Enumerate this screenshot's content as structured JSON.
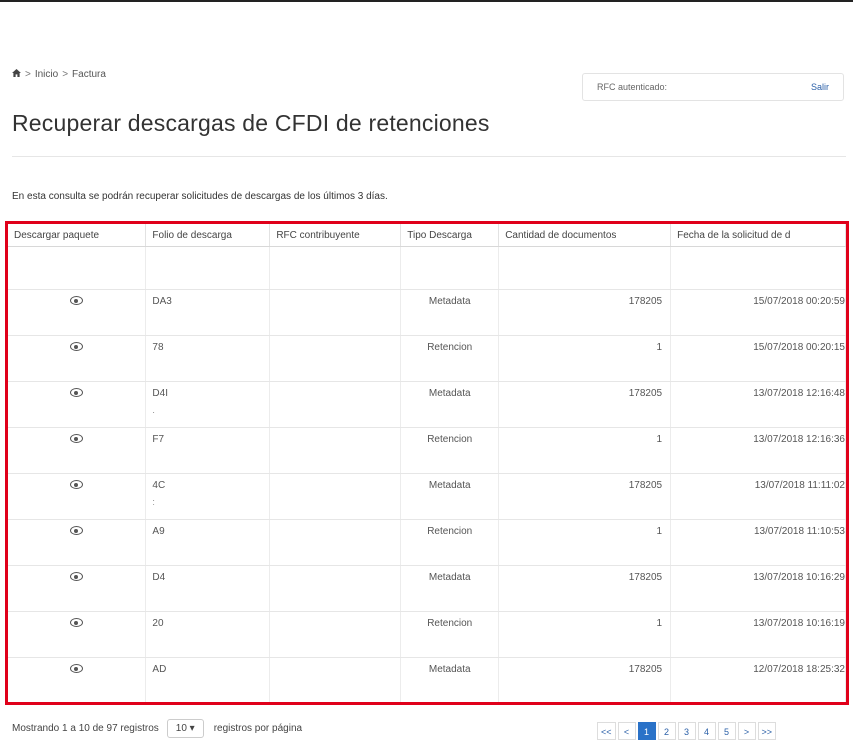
{
  "breadcrumb": {
    "home_icon": "home-icon",
    "items": [
      "Inicio",
      "Factura"
    ],
    "separator": ">"
  },
  "auth": {
    "label": "RFC autenticado:",
    "logout": "Salir"
  },
  "page": {
    "title": "Recuperar descargas de CFDI de retenciones",
    "description": "En esta consulta se podrán recuperar solicitudes de descargas de los últimos 3 días."
  },
  "table": {
    "columns": [
      "Descargar paquete",
      "Folio de descarga",
      "RFC contribuyente",
      "Tipo Descarga",
      "Cantidad de documentos",
      "Fecha de la solicitud de d"
    ],
    "rows": [
      {
        "folio": "DA3",
        "dot": "",
        "rfc": "",
        "tipo": "Metadata",
        "cantidad": "178205",
        "fecha": "15/07/2018 00:20:59"
      },
      {
        "folio": "78",
        "dot": "",
        "rfc": "",
        "tipo": "Retencion",
        "cantidad": "1",
        "fecha": "15/07/2018 00:20:15"
      },
      {
        "folio": "D4I",
        "dot": ".",
        "rfc": "",
        "tipo": "Metadata",
        "cantidad": "178205",
        "fecha": "13/07/2018 12:16:48"
      },
      {
        "folio": "F7",
        "dot": "",
        "rfc": "",
        "tipo": "Retencion",
        "cantidad": "1",
        "fecha": "13/07/2018 12:16:36"
      },
      {
        "folio": "4C",
        "dot": ":",
        "rfc": "",
        "tipo": "Metadata",
        "cantidad": "178205",
        "fecha": "13/07/2018 11:11:02"
      },
      {
        "folio": "A9",
        "dot": "",
        "rfc": "",
        "tipo": "Retencion",
        "cantidad": "1",
        "fecha": "13/07/2018 11:10:53"
      },
      {
        "folio": "D4",
        "dot": "",
        "rfc": "",
        "tipo": "Metadata",
        "cantidad": "178205",
        "fecha": "13/07/2018 10:16:29"
      },
      {
        "folio": "20",
        "dot": "",
        "rfc": "",
        "tipo": "Retencion",
        "cantidad": "1",
        "fecha": "13/07/2018 10:16:19"
      },
      {
        "folio": "AD",
        "dot": "",
        "rfc": "",
        "tipo": "Metadata",
        "cantidad": "178205",
        "fecha": "12/07/2018 18:25:32"
      }
    ]
  },
  "footer": {
    "showing": "Mostrando 1 a 10 de 97 registros",
    "page_size": "10 ▾",
    "per_page": "registros por página"
  },
  "pagination": [
    "<<",
    "<",
    "1",
    "2",
    "3",
    "4",
    "5",
    ">",
    ">>"
  ],
  "pagination_active": "1",
  "colors": {
    "highlight_border": "#e0001a",
    "link": "#2b60a8",
    "active_page": "#2a72c8"
  }
}
